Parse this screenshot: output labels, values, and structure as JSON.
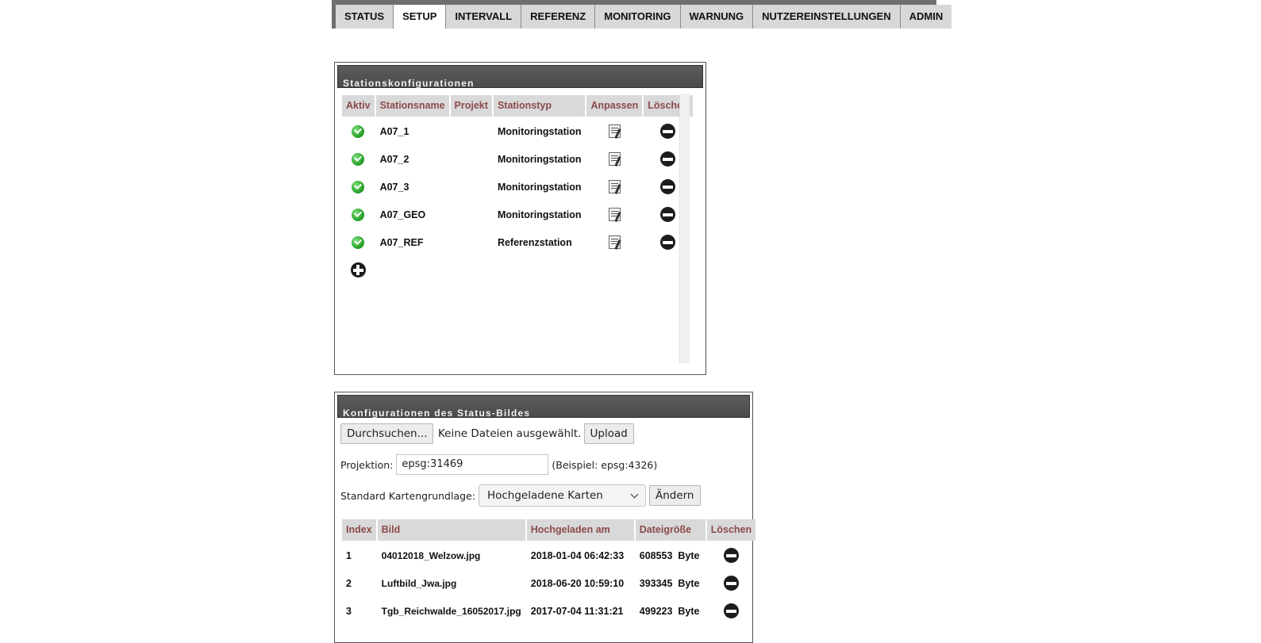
{
  "tabs": [
    {
      "label": "STATUS"
    },
    {
      "label": "SETUP",
      "active": true
    },
    {
      "label": "INTERVALL"
    },
    {
      "label": "REFERENZ"
    },
    {
      "label": "MONITORING"
    },
    {
      "label": "WARNUNG"
    },
    {
      "label": "NUTZEREINSTELLUNGEN"
    },
    {
      "label": "ADMIN"
    }
  ],
  "stations": {
    "title": "Stationskonfigurationen",
    "headers": [
      "Aktiv",
      "Stationsname",
      "Projekt",
      "Stationstyp",
      "Anpassen",
      "Löschen"
    ],
    "rows": [
      {
        "aktiv": "check-icon",
        "name": "A07_1",
        "projekt": "",
        "typ": "Monitoringstation"
      },
      {
        "aktiv": "check-icon",
        "name": "A07_2",
        "projekt": "",
        "typ": "Monitoringstation"
      },
      {
        "aktiv": "check-icon",
        "name": "A07_3",
        "projekt": "",
        "typ": "Monitoringstation"
      },
      {
        "aktiv": "check-icon",
        "name": "A07_GEO",
        "projekt": "",
        "typ": "Monitoringstation"
      },
      {
        "aktiv": "check-icon",
        "name": "A07_REF",
        "projekt": "",
        "typ": "Referenzstation"
      }
    ],
    "add_icon": "plus-circle-icon",
    "edit_icon": "edit-note-icon",
    "delete_icon": "minus-circle-icon"
  },
  "status_image": {
    "title": "Konfigurationen des Status-Bildes",
    "browse_label": "Durchsuchen...",
    "no_file_text": "Keine Dateien ausgewählt.",
    "upload_label": "Upload",
    "projection_label": "Projektion:",
    "projection_value": "epsg:31469",
    "projection_hint": "(Beispiel: epsg:4326)",
    "basemap_label": "Standard Kartengrundlage:",
    "basemap_selected": "Hochgeladene Karten",
    "change_label": "Ändern",
    "headers": [
      "Index",
      "Bild",
      "Hochgeladen am",
      "Dateigröße",
      "Löschen"
    ],
    "rows": [
      {
        "index": "1",
        "bild": "04012018_Welzow.jpg",
        "datum": "2018-01-04 06:42:33",
        "groesse": "608553  Byte"
      },
      {
        "index": "2",
        "bild": "Luftbild_Jwa.jpg",
        "datum": "2018-06-20 10:59:10",
        "groesse": "393345  Byte"
      },
      {
        "index": "3",
        "bild": "Tgb_Reichwalde_16052017.jpg",
        "datum": "2017-07-04 11:31:21",
        "groesse": "499223  Byte"
      }
    ]
  },
  "colors": {
    "tab_bar": "#6f6f6f",
    "header_text": "#8b4a4a",
    "panel_title_bg": "#4f4f4f"
  }
}
